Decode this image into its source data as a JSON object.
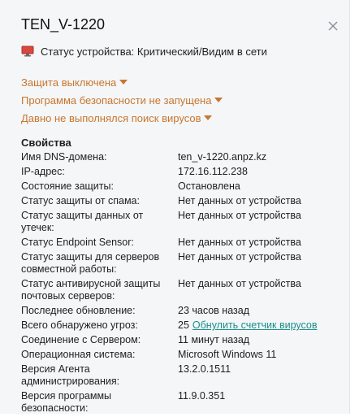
{
  "header": {
    "title": "TEN_V-1220",
    "status_text": "Статус устройства: Критический/Видим в сети"
  },
  "alerts": [
    {
      "label": "Защита выключена"
    },
    {
      "label": "Программа безопасности не запущена"
    },
    {
      "label": "Давно не выполнялся поиск вирусов"
    }
  ],
  "properties": {
    "section_title": "Свойства",
    "rows": [
      {
        "key": "Имя DNS-домена:",
        "value": "ten_v-1220.anpz.kz"
      },
      {
        "key": "IP-адрес:",
        "value": "172.16.112.238"
      },
      {
        "key": "Состояние защиты:",
        "value": "Остановлена"
      },
      {
        "key": "Статус защиты от спама:",
        "value": "Нет данных от устройства"
      },
      {
        "key": "Статус защиты данных от утечек:",
        "value": "Нет данных от устройства"
      },
      {
        "key": "Статус Endpoint Sensor:",
        "value": "Нет данных от устройства"
      },
      {
        "key": "Статус защиты для серверов совместной работы:",
        "value": "Нет данных от устройства"
      },
      {
        "key": "Статус антивирусной защиты почтовых серверов:",
        "value": "Нет данных от устройства"
      },
      {
        "key": "Последнее обновление:",
        "value": "23 часов назад"
      },
      {
        "key": "Всего обнаружено угроз:",
        "value": "25",
        "link": "Обнулить счетчик вирусов"
      },
      {
        "key": "Соединение с Сервером:",
        "value": "11 минут назад"
      },
      {
        "key": "Операционная система:",
        "value": "Microsoft Windows 11"
      },
      {
        "key": "Версия Агента администрирования:",
        "value": "13.2.0.1511"
      },
      {
        "key": "Версия программы безопасности:",
        "value": "11.9.0.351"
      }
    ]
  },
  "colors": {
    "alert": "#c8762e",
    "link": "#1a8f8a",
    "status_icon": "#d9473f"
  },
  "icons": {
    "close": "close-icon",
    "status": "monitor-critical-icon",
    "alert_caret": "caret-down-icon"
  }
}
